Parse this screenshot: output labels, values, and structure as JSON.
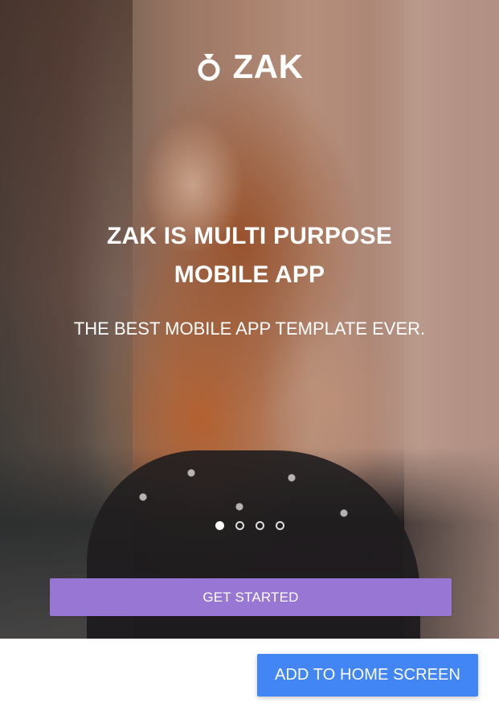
{
  "brand": {
    "name": "ZAK",
    "icon": "diamond-ring-icon"
  },
  "hero": {
    "headline": "ZAK IS MULTI PURPOSE MOBILE APP",
    "subheadline": "THE BEST MOBILE APP TEMPLATE EVER.",
    "slides_total": 4,
    "slide_active_index": 1
  },
  "buttons": {
    "get_started": "GET STARTED",
    "add_to_home_screen": "ADD TO HOME SCREEN"
  },
  "colors": {
    "primary_purple": "#9877d4",
    "primary_blue": "#4285f4"
  }
}
